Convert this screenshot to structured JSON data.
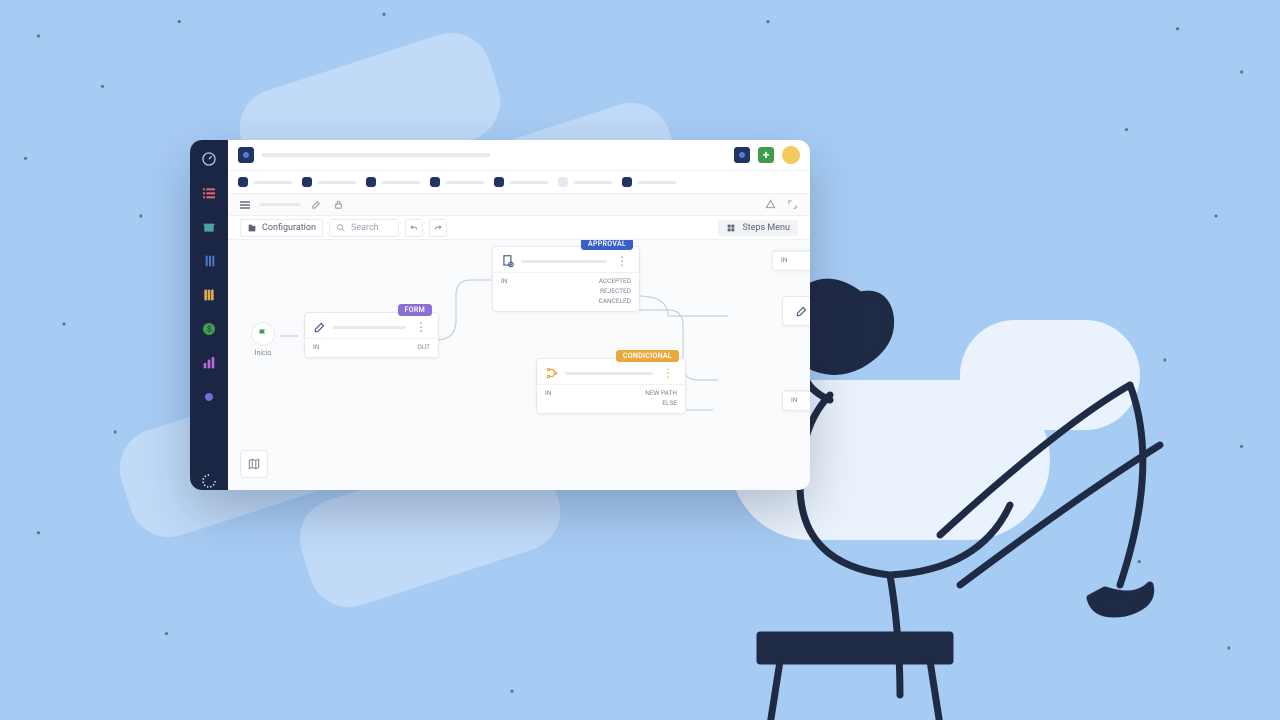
{
  "toolbar": {
    "configuration_label": "Configuration",
    "search_placeholder": "Search",
    "steps_menu_label": "Steps Menu"
  },
  "nodes": {
    "start_label": "Inicio",
    "form": {
      "tag": "FORM",
      "port_in": "IN",
      "port_out": "OUT"
    },
    "approval": {
      "tag": "APPROVAL",
      "port_in": "IN",
      "accepted": "ACCEPTED",
      "rejected": "REJECTED",
      "canceled": "CANCELED"
    },
    "conditional": {
      "tag": "CONDICIONAL",
      "port_in": "IN",
      "new_path": "NEW PATH",
      "else": "ELSE"
    },
    "side1_in": "IN",
    "side2_in": "IN"
  },
  "colors": {
    "navy": "#223463",
    "green": "#3f9c4f",
    "purple": "#8c6fd6",
    "blue": "#3a5fc8",
    "amber": "#e7a93c"
  }
}
